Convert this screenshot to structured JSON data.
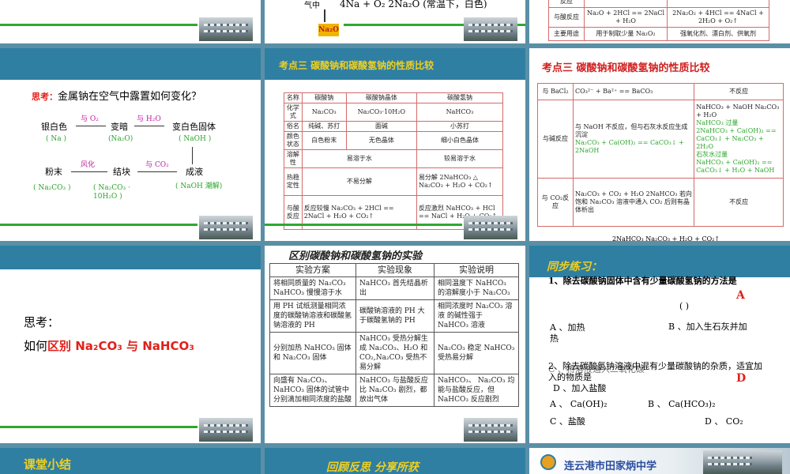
{
  "colors": {
    "banner": "#2f7fa3",
    "green_line": "#2fa82f",
    "accent_red": "#e0201a",
    "accent_green": "#2aa52a"
  },
  "s2": {
    "top_text": "4Na + O₂  2Na₂O (常温下，白色)",
    "label_gas": "气中",
    "label_na2o": "Na₂O"
  },
  "s3": {
    "row_label_a": "反应",
    "row_label_b": "与酸反应",
    "row_label_c": "主要用途",
    "acid_a": "Na₂O + 2HCl == 2NaCl + H₂O",
    "acid_b": "2Na₂O₂ + 4HCl == 4NaCl + 2H₂O + O₂↑",
    "use_a": "用于制取少量 Na₂O₂",
    "use_b": "强氧化剂、漂白剂、供氧剂"
  },
  "s4": {
    "think_label": "思考：",
    "question": "金属钠在空气中露置如何变化？",
    "n1": "银白色",
    "n1s": "( Na )",
    "a1": "与 O₂",
    "n2": "变暗",
    "n2s": "(Na₂O)",
    "a2": "与 H₂O",
    "n3": "变白色固体",
    "n3s": "( NaOH )",
    "n4": "成液",
    "n4s": "( NaOH 潮解)",
    "a4": "与 CO₂",
    "n5": "结块",
    "n5s": "( Na₂CO₃ · 10H₂O )",
    "a5": "风化",
    "n6": "粉末",
    "n6s": "( Na₂CO₃ )"
  },
  "s5": {
    "title": "考点三  碳酸钠和碳酸氢钠的性质比较",
    "headers": [
      "名称",
      "碳酸钠",
      "碳酸钠晶体",
      "碳酸氢钠"
    ],
    "rows": [
      [
        "化学式",
        "Na₂CO₃",
        "Na₂CO₃·10H₂O",
        "NaHCO₃"
      ],
      [
        "俗名",
        "纯碱、苏打",
        "面碱",
        "小苏打"
      ],
      [
        "颜色状态",
        "白色粉末",
        "无色晶体",
        "细小白色晶体"
      ]
    ],
    "solubility_label": "溶解性",
    "solubility_a": "易溶于水",
    "solubility_b": "较易溶于水",
    "stability_label": "热稳定性",
    "stability_a": "不易分解",
    "stability_b": "易分解 2NaHCO₃ △ Na₂CO₃ + H₂O + CO₂↑",
    "acid_label": "与酸反应",
    "acid_a": "反应较慢 Na₂CO₃ + 2HCl == 2NaCl + H₂O + CO₂↑",
    "acid_b": "反应激烈 NaHCO₃ + HCl == NaCl + H₂O + CO₂↑"
  },
  "s6": {
    "title": "考点三  碳酸钠和碳酸氢钠的性质比较",
    "bacl2_label": "与 BaCl₂",
    "bacl2_a": "CO₃²⁻ + Ba²⁺ == BaCO₃",
    "bacl2_b": "不反应",
    "base_label": "与碱反应",
    "base_a1": "与 NaOH 不反应，但与石灰水反应生成沉淀",
    "base_a2": "Na₂CO₃ + Ca(OH)₂ == CaCO₃↓ + 2NaOH",
    "base_b1": "NaHCO₃ + NaOH    Na₂CO₃ + H₂O",
    "base_b2": "NaHCO₃ 过量",
    "base_b3": "2NaHCO₃ + Ca(OH)₂ == CaCO₃↓ + Na₂CO₃ + 2H₂O",
    "base_b4": "石灰水过量",
    "base_b5": "NaHCO₃ + Ca(OH)₂ == CaCO₃↓ + H₂O + NaOH",
    "co2_label": "与 CO₂反应",
    "co2_a": "Na₂CO₃ + CO₂ + H₂O  2NaHCO₃  若向饱和 Na₂CO₃ 溶液中通入 CO₂ 后则有晶体析出",
    "co2_b": "不反应",
    "bottom": "2NaHCO₃   Na₂CO₃ + H₂O + CO₂↑"
  },
  "s7": {
    "think": "思考：",
    "prefix": "如何",
    "highlight": "区别 Na₂CO₃ 与 NaHCO₃"
  },
  "s8": {
    "title": "区别碳酸钠和碳酸氢钠的实验",
    "headers": [
      "实验方案",
      "实验现象",
      "实验说明"
    ],
    "rows": [
      [
        "将相同质量的 Na₂CO₃ NaHCO₃ 慢慢溶于水",
        "NaHCO₃ 首先结晶析出",
        "相同温度下 NaHCO₃ 的溶解度小于 Na₂CO₃"
      ],
      [
        "用 PH 试纸测量相同浓度的碳酸钠溶液和碳酸氢钠溶液的 PH",
        "碳酸钠溶液的 PH 大于碳酸氢钠的 PH",
        "相同浓度时 Na₂CO₃ 溶液 的碱性强于 NaHCO₃ 溶液"
      ],
      [
        "分别加热 NaHCO₃ 固体和 Na₂CO₃ 固体",
        "NaHCO₃ 受热分解生成 Na₂CO₃、H₂O 和 CO₂,Na₂CO₃ 受热不易分解",
        "Na₂CO₃ 稳定 NaHCO₃ 受热易分解"
      ],
      [
        "向盛有 Na₂CO₃、NaHCO₃ 固体的试管中分别滴加相同浓度的盐酸",
        "NaHCO₃ 与盐酸反应比 Na₂CO₃ 剧烈，都放出气体",
        "NaHCO₃、 Na₂CO₃ 均能与盐酸反应，但 NaHCO₃ 反应剧烈"
      ]
    ]
  },
  "s9": {
    "title": "同步练习：",
    "q1": "1、除去碳酸钠固体中含有少量碳酸氢钠的方法是",
    "q1_paren": "(        )",
    "q1_ans": "A",
    "q1_a": "A 、加热",
    "q1_b": "B 、加入生石灰并加热",
    "q2": "2、除去碳酸氢钠溶液中混有少量碳酸钠的杂质，适宜加入的物质是",
    "q2_ans": "D",
    "q2_c": "C 、将溶液通入二氧化碳",
    "q2_d": "D 、加入盐酸",
    "q2_a": "A 、 Ca(OH)₂",
    "q2_b": "B 、 Ca(HCO₃)₂",
    "q2_c2": "C 、盐酸",
    "q2_d2": "D 、 CO₂"
  },
  "s10": {
    "title": "课堂小结"
  },
  "s11": {
    "title": "回顾反思  分享所获"
  },
  "s12": {
    "school": "连云港市田家炳中学"
  }
}
